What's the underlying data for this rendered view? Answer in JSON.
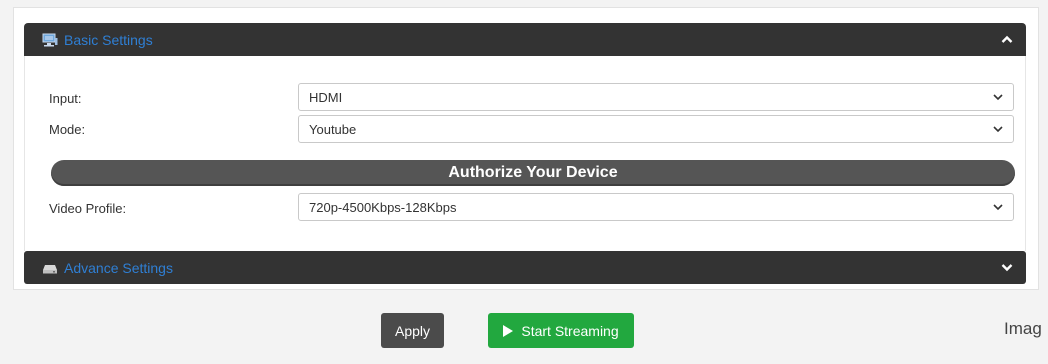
{
  "basic_settings": {
    "title": "Basic Settings",
    "icon": "monitor-icon",
    "toggle_icon": "chevron-up-icon",
    "rows": [
      {
        "label": "Input:",
        "value": "HDMI"
      },
      {
        "label": "Mode:",
        "value": "Youtube"
      }
    ],
    "authorize_label": "Authorize Your Device",
    "video_profile": {
      "label": "Video Profile:",
      "value": "720p-4500Kbps-128Kbps"
    }
  },
  "advance_settings": {
    "title": "Advance Settings",
    "icon": "drive-icon",
    "toggle_icon": "chevron-down-icon"
  },
  "actions": {
    "apply_label": "Apply",
    "start_label": "Start Streaming"
  },
  "clipped_text": "Imag",
  "colors": {
    "header_bg": "#333333",
    "header_title": "#2f7fd4",
    "authorize_bg": "#555555",
    "apply_bg": "#4b4b4b",
    "start_bg": "#22a83f"
  }
}
